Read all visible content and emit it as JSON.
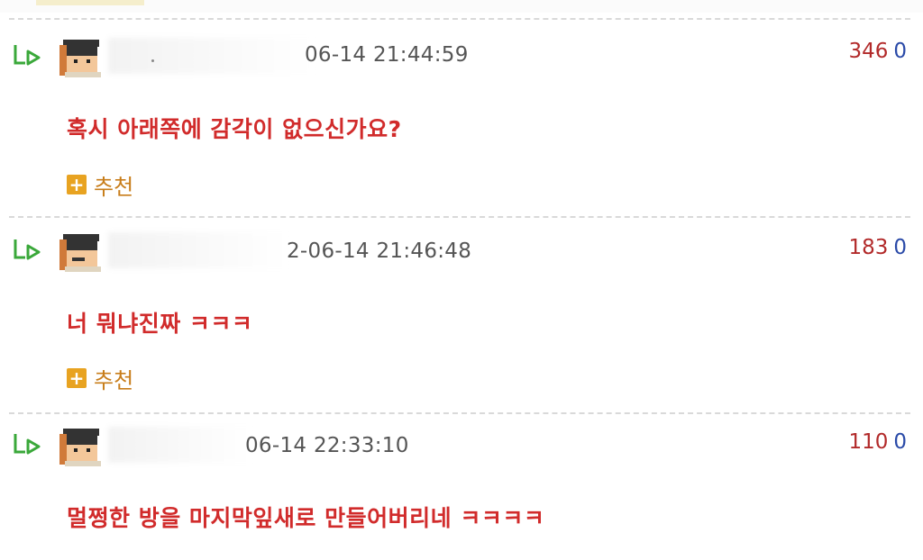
{
  "comments": [
    {
      "date": "06-14 21:44:59",
      "upvotes": "346",
      "downvotes": "0",
      "text": "혹시 아래쪽에 감각이 없으신가요?",
      "recommend_label": "추천"
    },
    {
      "date": "2-06-14 21:46:48",
      "upvotes": "183",
      "downvotes": "0",
      "text": "너 뭐냐진짜 ㅋㅋㅋ",
      "recommend_label": "추천"
    },
    {
      "date": "06-14 22:33:10",
      "upvotes": "110",
      "downvotes": "0",
      "text": "멀쩡한 방을 마지막잎새로 만들어버리네 ㅋㅋㅋㅋ"
    }
  ],
  "colors": {
    "comment_text": "#d12b2b",
    "upvote": "#b22a2a",
    "downvote": "#2a4aa8",
    "recommend": "#e8a321",
    "reply_arrow": "#3aa83a"
  },
  "icons": [
    "reply-arrow-icon",
    "avatar-icon",
    "plus-icon"
  ]
}
